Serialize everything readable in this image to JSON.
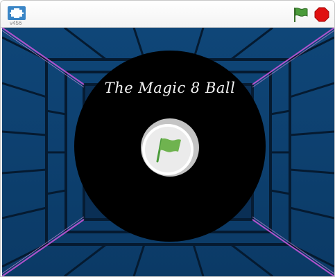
{
  "toolbar": {
    "version_label": "v456",
    "fullscreen_icon": "fullscreen-icon",
    "green_flag_icon": "green-flag-icon",
    "stop_icon": "stop-sign-icon",
    "flag_color": "#4a9b3a",
    "stop_color": "#e01010"
  },
  "stage": {
    "title": "The Magic 8 Ball",
    "start_icon": "green-flag-icon",
    "ball_color": "#000000",
    "backdrop_color": "#0d3f6e",
    "accent_color": "#c455d8"
  }
}
